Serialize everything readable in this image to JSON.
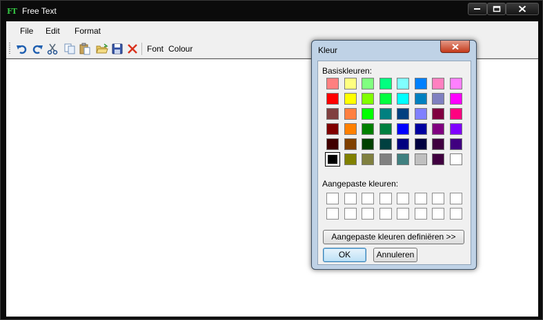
{
  "window": {
    "title": "Free Text",
    "icon_text": "FT"
  },
  "menu": {
    "items": [
      "File",
      "Edit",
      "Format"
    ]
  },
  "toolbar": {
    "icons": [
      "undo-icon",
      "redo-icon",
      "cut-icon",
      "copy-icon",
      "paste-icon",
      "open-icon",
      "save-icon",
      "delete-icon"
    ],
    "font_label": "Font",
    "colour_label": "Colour"
  },
  "dialog": {
    "title": "Kleur",
    "basic_label": "Basiskleuren:",
    "custom_label": "Aangepaste kleuren:",
    "basic_colors": [
      "#ff8080",
      "#ffff80",
      "#80ff80",
      "#00ff80",
      "#80ffff",
      "#0080ff",
      "#ff80c0",
      "#ff80ff",
      "#ff0000",
      "#ffff00",
      "#80ff00",
      "#00ff40",
      "#00ffff",
      "#0080c0",
      "#8080c0",
      "#ff00ff",
      "#804040",
      "#ff8040",
      "#00ff00",
      "#008080",
      "#004080",
      "#8080ff",
      "#800040",
      "#ff0080",
      "#800000",
      "#ff8000",
      "#008000",
      "#008040",
      "#0000ff",
      "#0000a0",
      "#800080",
      "#8000ff",
      "#400000",
      "#804000",
      "#004000",
      "#004040",
      "#000080",
      "#000040",
      "#400040",
      "#400080",
      "#000000",
      "#808000",
      "#808040",
      "#808080",
      "#408080",
      "#c0c0c0",
      "#400040",
      "#ffffff"
    ],
    "selected_color": "#000000",
    "define_button": "Aangepaste kleuren definiëren >>",
    "ok_button": "OK",
    "cancel_button": "Annuleren"
  }
}
